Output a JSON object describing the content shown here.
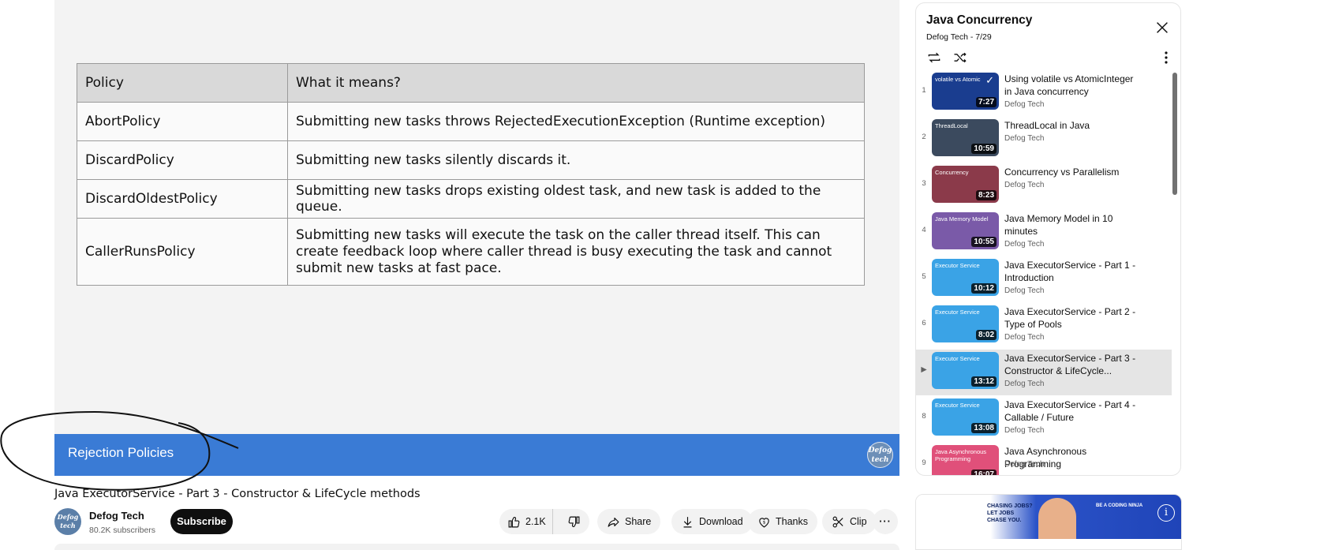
{
  "video": {
    "slide_table": {
      "header": [
        "Policy",
        "What it means?"
      ],
      "rows": [
        [
          "AbortPolicy",
          "Submitting new tasks throws RejectedExecutionException (Runtime exception)"
        ],
        [
          "DiscardPolicy",
          "Submitting new tasks silently discards it."
        ],
        [
          "DiscardOldestPolicy",
          "Submitting new tasks drops existing oldest task, and new task is added to the queue."
        ],
        [
          "CallerRunsPolicy",
          "Submitting new tasks will execute the task on the caller thread itself. This can create feedback loop where caller thread is busy executing the task and cannot submit new tasks at fast pace."
        ]
      ]
    },
    "slide_footer_title": "Rejection Policies",
    "badge_text": "Defog tech",
    "title": "Java ExecutorService - Part 3 - Constructor & LifeCycle methods"
  },
  "channel": {
    "name": "Defog Tech",
    "subscribers": "80.2K subscribers",
    "avatar_text": "Defog tech",
    "subscribe_label": "Subscribe"
  },
  "actions": {
    "likes": "2.1K",
    "share": "Share",
    "download": "Download",
    "thanks": "Thanks",
    "clip": "Clip",
    "more": "···"
  },
  "playlist": {
    "title": "Java Concurrency",
    "subtitle": "Defog Tech - 7/29",
    "items": [
      {
        "idx": "1",
        "title": "Using volatile vs AtomicInteger in Java concurrency",
        "channel": "Defog Tech",
        "duration": "7:27",
        "thumb_label": "volatile vs Atomic",
        "thumb_color": "#1a3d8f",
        "watched": true
      },
      {
        "idx": "2",
        "title": "ThreadLocal in Java",
        "channel": "Defog Tech",
        "duration": "10:59",
        "thumb_label": "ThreadLocal",
        "thumb_color": "#3b4a5e"
      },
      {
        "idx": "3",
        "title": "Concurrency vs Parallelism",
        "channel": "Defog Tech",
        "duration": "8:23",
        "thumb_label": "Concurrency",
        "thumb_color": "#8b3a4a"
      },
      {
        "idx": "4",
        "title": "Java Memory Model in 10 minutes",
        "channel": "Defog Tech",
        "duration": "10:55",
        "thumb_label": "Java Memory Model",
        "thumb_color": "#7a5aa8"
      },
      {
        "idx": "5",
        "title": "Java ExecutorService - Part 1 - Introduction",
        "channel": "Defog Tech",
        "duration": "10:12",
        "thumb_label": "Executor Service",
        "thumb_color": "#3aa3e6"
      },
      {
        "idx": "6",
        "title": "Java ExecutorService - Part 2 - Type of Pools",
        "channel": "Defog Tech",
        "duration": "8:02",
        "thumb_label": "Executor Service",
        "thumb_color": "#3aa3e6"
      },
      {
        "idx": "▶",
        "title": "Java ExecutorService - Part 3 - Constructor & LifeCycle...",
        "channel": "Defog Tech",
        "duration": "13:12",
        "thumb_label": "Executor Service",
        "thumb_color": "#3aa3e6",
        "active": true
      },
      {
        "idx": "8",
        "title": "Java ExecutorService - Part 4 - Callable / Future",
        "channel": "Defog Tech",
        "duration": "13:08",
        "thumb_label": "Executor Service",
        "thumb_color": "#3aa3e6"
      },
      {
        "idx": "9",
        "title": "Java Asynchronous Programming",
        "channel": "Defog Tech",
        "duration": "16:07",
        "thumb_label": "Java Asynchronous Programming",
        "thumb_color": "#e0507a"
      }
    ]
  },
  "ad": {
    "left_text": "CHASING JOBS? LET JOBS CHASE YOU.",
    "right_text": "BE A CODING NINJA",
    "info": "i"
  },
  "colors": {
    "slide_footer": "#3a7bd5",
    "subscribe_bg": "#0f0f0f",
    "active_row": "#e5e5e5"
  }
}
